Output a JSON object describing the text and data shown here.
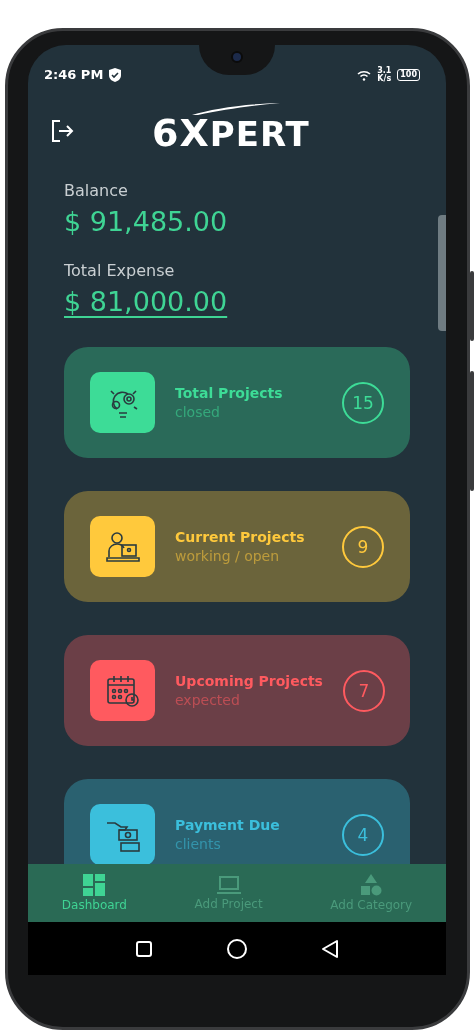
{
  "status_bar": {
    "time": "2:46 PM",
    "speed": [
      "3.1",
      "K/s"
    ],
    "battery": "100"
  },
  "header": {
    "logo": {
      "numeral": "6",
      "x": "X",
      "rest": "PERT"
    }
  },
  "summary": [
    {
      "label": "Balance",
      "value": "$ 91,485.00",
      "underlined": false
    },
    {
      "label": "Total Expense",
      "value": "$ 81,000.00",
      "underlined": true
    }
  ],
  "cards": [
    {
      "title": "Total Projects",
      "subtitle": "closed",
      "count": "15",
      "color": "#3ddc97"
    },
    {
      "title": "Current Projects",
      "subtitle": "working / open",
      "count": "9",
      "color": "#ffc93c"
    },
    {
      "title": "Upcoming Projects",
      "subtitle": "expected",
      "count": "7",
      "color": "#ff5a5f"
    },
    {
      "title": "Payment Due",
      "subtitle": "clients",
      "count": "4",
      "color": "#3bbfdc"
    }
  ],
  "bottom_nav": [
    {
      "label": "Dashboard",
      "selected": true
    },
    {
      "label": "Add Project",
      "selected": false
    },
    {
      "label": "Add Category",
      "selected": false
    }
  ]
}
